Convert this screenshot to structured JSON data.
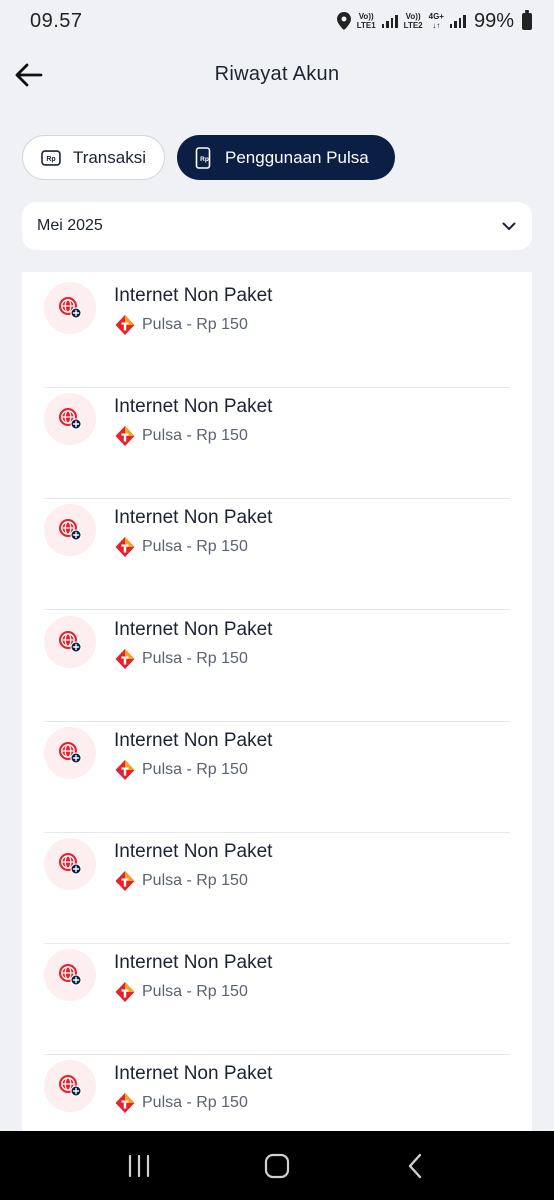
{
  "status_bar": {
    "time": "09.57",
    "sim1_top": "Vo))",
    "sim1_bottom": "LTE1",
    "sim2_top": "Vo))",
    "sim2_bottom": "LTE2",
    "network": "4G+",
    "battery": "99%"
  },
  "header": {
    "title": "Riwayat Akun"
  },
  "tabs": [
    {
      "label": "Transaksi",
      "active": false
    },
    {
      "label": "Penggunaan Pulsa",
      "active": true
    }
  ],
  "filter": {
    "month": "Mei 2025"
  },
  "items": [
    {
      "title": "Internet Non Paket",
      "subtitle": "Pulsa - Rp 150"
    },
    {
      "title": "Internet Non Paket",
      "subtitle": "Pulsa - Rp 150"
    },
    {
      "title": "Internet Non Paket",
      "subtitle": "Pulsa - Rp 150"
    },
    {
      "title": "Internet Non Paket",
      "subtitle": "Pulsa - Rp 150"
    },
    {
      "title": "Internet Non Paket",
      "subtitle": "Pulsa - Rp 150"
    },
    {
      "title": "Internet Non Paket",
      "subtitle": "Pulsa - Rp 150"
    },
    {
      "title": "Internet Non Paket",
      "subtitle": "Pulsa - Rp 150"
    },
    {
      "title": "Internet Non Paket",
      "subtitle": "Pulsa - Rp 150"
    }
  ],
  "colors": {
    "primary": "#0b1f45",
    "accent": "#e3232f",
    "background": "#eff1f5"
  },
  "icons": {
    "back": "arrow-left-icon",
    "transaksi": "rp-card-icon",
    "pulsa": "phone-rp-icon",
    "dropdown": "chevron-down-icon",
    "item": "globe-plus-icon",
    "brand": "telkomsel-logo-icon"
  }
}
